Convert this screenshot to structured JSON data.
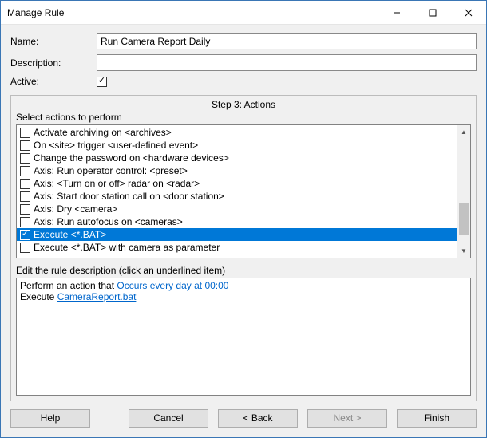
{
  "window": {
    "title": "Manage Rule"
  },
  "form": {
    "name_label": "Name:",
    "name_value": "Run Camera Report Daily",
    "description_label": "Description:",
    "description_value": "",
    "active_label": "Active:"
  },
  "step": {
    "header": "Step 3: Actions",
    "select_label": "Select actions to perform",
    "actions": [
      {
        "checked": false,
        "label": "Activate archiving on <archives>"
      },
      {
        "checked": false,
        "label": "On <site> trigger <user-defined event>"
      },
      {
        "checked": false,
        "label": "Change the password on <hardware devices>"
      },
      {
        "checked": false,
        "label": "Axis: Run operator control: <preset>"
      },
      {
        "checked": false,
        "label": "Axis: <Turn on or off> radar on <radar>"
      },
      {
        "checked": false,
        "label": "Axis: Start door station call on <door station>"
      },
      {
        "checked": false,
        "label": "Axis: Dry <camera>"
      },
      {
        "checked": false,
        "label": "Axis: Run autofocus on <cameras>"
      },
      {
        "checked": true,
        "label": "Execute <*.BAT>",
        "selected": true
      },
      {
        "checked": false,
        "label": "Execute <*.BAT> with camera as parameter"
      }
    ],
    "desc_label": "Edit the rule description (click an underlined item)",
    "desc_line1_prefix": "Perform an action that ",
    "desc_line1_link": "Occurs every day at 00:00",
    "desc_line2_prefix": "Execute ",
    "desc_line2_link": "CameraReport.bat"
  },
  "buttons": {
    "help": "Help",
    "cancel": "Cancel",
    "back": "< Back",
    "next": "Next >",
    "finish": "Finish"
  }
}
